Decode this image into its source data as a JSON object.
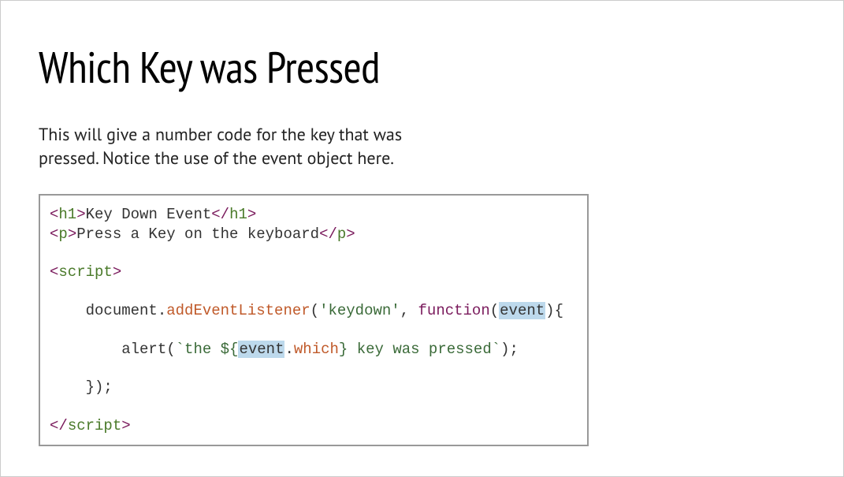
{
  "title": "Which Key was Pressed",
  "description": "This will give a number code for the key that was pressed. Notice the use of the event object here.",
  "code": {
    "line1": {
      "open1": "<",
      "tag1": "h1",
      "close1": ">",
      "text1": "Key Down Event",
      "open2": "</",
      "tag2": "h1",
      "close2": ">"
    },
    "line2": {
      "open1": "<",
      "tag1": "p",
      "close1": ">",
      "text1": "Press a Key on the keyboard",
      "open2": "</",
      "tag2": "p",
      "close2": ">"
    },
    "line3": {
      "open1": "<",
      "tag1": "script",
      "close1": ">"
    },
    "line4": {
      "indent": "    ",
      "obj": "document.",
      "method": "addEventListener",
      "paren": "(",
      "str": "'keydown'",
      "comma": ", ",
      "kw": "function",
      "paren2": "(",
      "param": "event",
      "paren3": ")",
      "brace": "{"
    },
    "line5": {
      "indent": "        ",
      "call": "alert(",
      "tick1": "`the ${",
      "evt": "event",
      "dot": ".",
      "prop": "which",
      "tick2": "} key was pressed`",
      "end": ");"
    },
    "line6": {
      "indent": "    ",
      "close": "});"
    },
    "line7": {
      "open1": "</",
      "tag1": "script",
      "close1": ">"
    }
  }
}
